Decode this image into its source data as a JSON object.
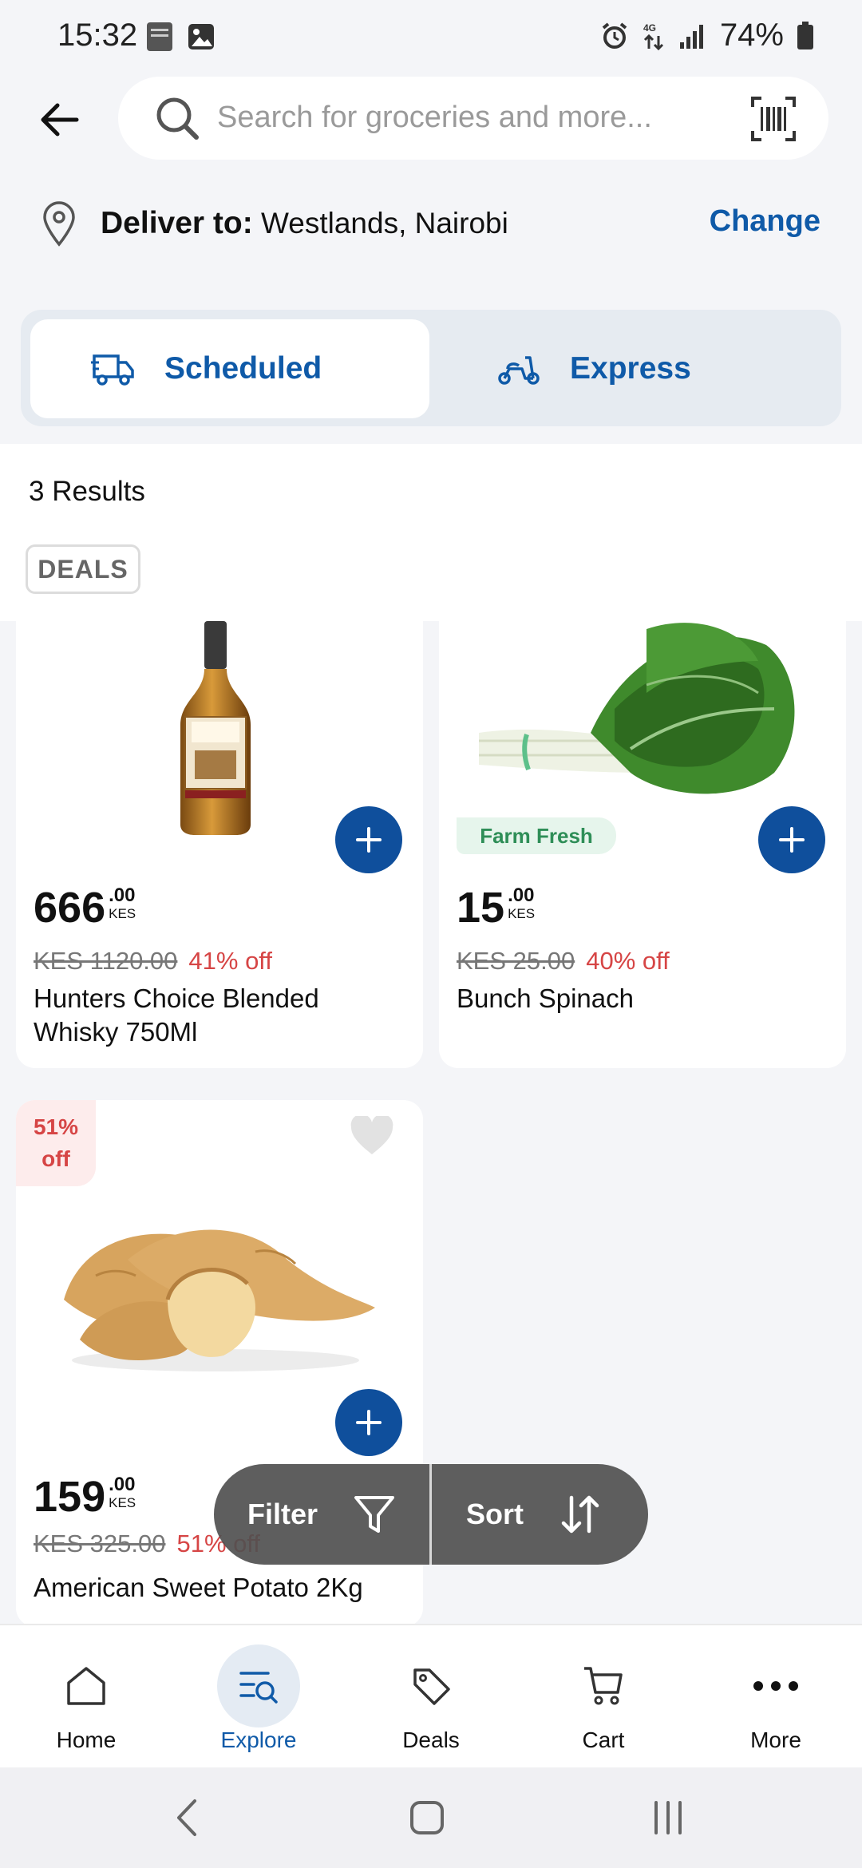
{
  "status_bar": {
    "time": "15:32",
    "battery": "74%"
  },
  "search": {
    "placeholder": "Search for groceries and more..."
  },
  "delivery": {
    "label": "Deliver to:",
    "location": "Westlands, Nairobi",
    "change_label": "Change"
  },
  "mode_tabs": [
    {
      "label": "Scheduled",
      "icon": "delivery-truck-icon",
      "active": true
    },
    {
      "label": "Express",
      "icon": "scooter-icon",
      "active": false
    }
  ],
  "results": {
    "count_text": "3 Results",
    "chip_label": "DEALS"
  },
  "products": [
    {
      "name": "Hunters Choice Blended Whisky 750Ml",
      "price_whole": "666",
      "price_cents": ".00",
      "currency": "KES",
      "old_price": "KES 1120.00",
      "discount": "41% off"
    },
    {
      "name": "Bunch Spinach",
      "badge": "Farm Fresh",
      "price_whole": "15",
      "price_cents": ".00",
      "currency": "KES",
      "old_price": "KES 25.00",
      "discount": "40% off"
    },
    {
      "name": "American Sweet Potato 2Kg",
      "badge_top": "51%",
      "badge_bottom": "off",
      "price_whole": "159",
      "price_cents": ".00",
      "currency": "KES",
      "old_price": "KES 325.00",
      "discount": "51% off"
    }
  ],
  "filter_sort": {
    "filter_label": "Filter",
    "sort_label": "Sort"
  },
  "bottom_nav": [
    {
      "label": "Home",
      "icon": "home-icon",
      "active": false
    },
    {
      "label": "Explore",
      "icon": "explore-icon",
      "active": true
    },
    {
      "label": "Deals",
      "icon": "tag-icon",
      "active": false
    },
    {
      "label": "Cart",
      "icon": "cart-icon",
      "active": false
    },
    {
      "label": "More",
      "icon": "more-icon",
      "active": false
    }
  ],
  "colors": {
    "brand_blue": "#0f5aa8",
    "button_blue": "#0f4f9c",
    "discount_red": "#d64545",
    "fresh_green": "#2e8e57"
  }
}
